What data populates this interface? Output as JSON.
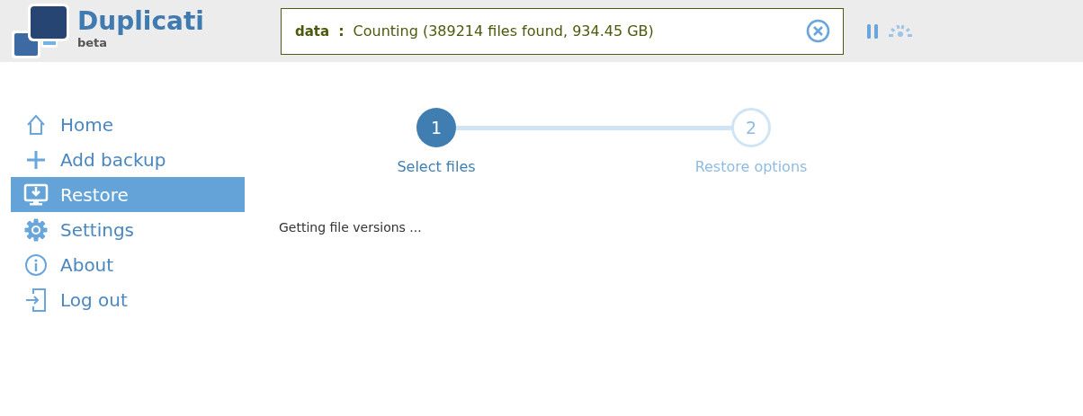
{
  "header": {
    "app_name": "Duplicati",
    "edition": "beta"
  },
  "status": {
    "backup_name": "data",
    "separator": ":",
    "message": "Counting (389214 files found, 934.45 GB)"
  },
  "sidebar": {
    "items": [
      {
        "label": "Home",
        "selected": false
      },
      {
        "label": "Add backup",
        "selected": false
      },
      {
        "label": "Restore",
        "selected": true
      },
      {
        "label": "Settings",
        "selected": false
      },
      {
        "label": "About",
        "selected": false
      },
      {
        "label": "Log out",
        "selected": false
      }
    ]
  },
  "wizard": {
    "steps": [
      {
        "number": "1",
        "label": "Select files",
        "active": true
      },
      {
        "number": "2",
        "label": "Restore options",
        "active": false
      }
    ]
  },
  "message": "Getting file versions ..."
}
